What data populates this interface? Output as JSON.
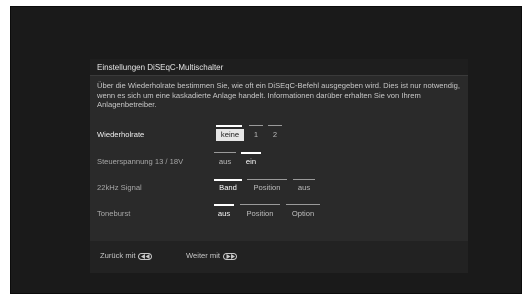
{
  "dialog": {
    "title": "Einstellungen DiSEqC-Multischalter",
    "description": "Über die Wiederholrate bestimmen Sie, wie oft ein DiSEqC-Befehl ausgegeben wird. Dies ist nur notwendig, wenn es sich um eine kaskadierte Anlage handelt. Informationen darüber erhalten Sie von Ihrem Anlagenbetreiber."
  },
  "settings": [
    {
      "label": "Wiederholrate",
      "options": [
        "keine",
        "1",
        "2"
      ],
      "selected": "keine",
      "active": true
    },
    {
      "label": "Steuerspannung 13 / 18V",
      "options": [
        "aus",
        "ein"
      ],
      "selected": "ein",
      "active": false
    },
    {
      "label": "22kHz Signal",
      "options": [
        "Band",
        "Position",
        "aus"
      ],
      "selected": "Band",
      "active": false
    },
    {
      "label": "Toneburst",
      "options": [
        "aus",
        "Position",
        "Option"
      ],
      "selected": "aus",
      "active": false
    }
  ],
  "footer": {
    "back_label": "Zurück mit",
    "back_icon": "rewind-icon",
    "next_label": "Weiter mit",
    "next_icon": "fast-forward-icon"
  },
  "colors": {
    "background": "#1a1a1a",
    "dialog": "#2a2a2a",
    "highlight": "#e6e6e6",
    "text": "#c8c8c8"
  }
}
